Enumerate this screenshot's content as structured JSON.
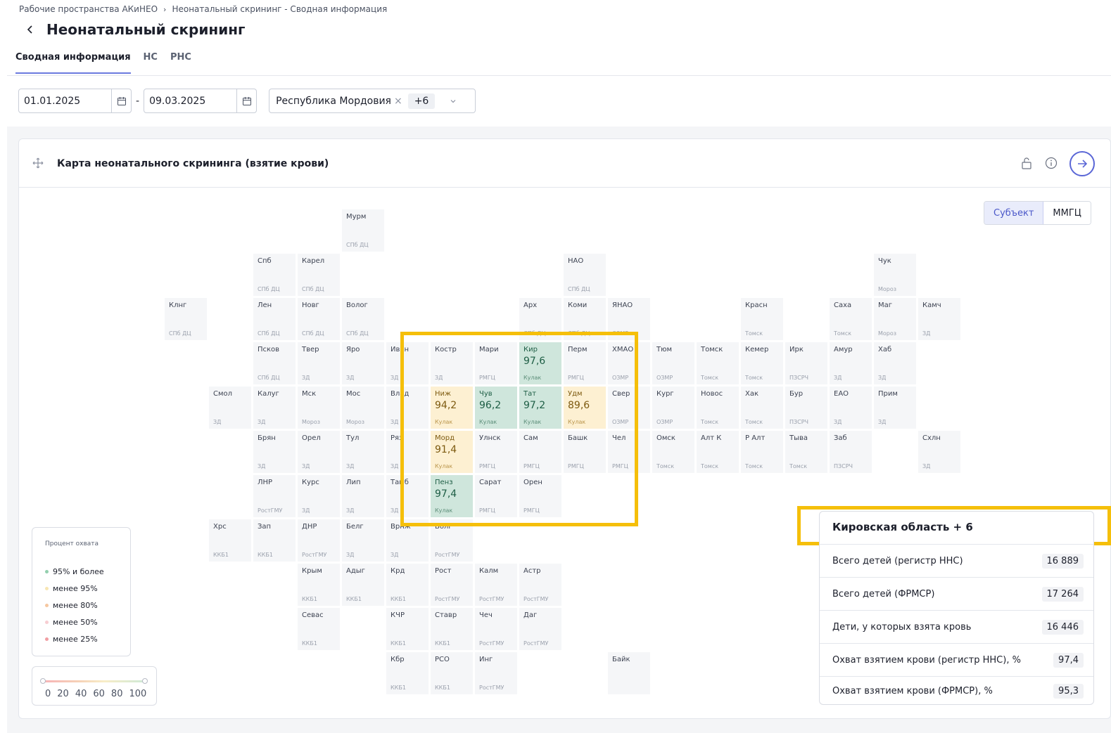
{
  "breadcrumb": {
    "root": "Рабочие пространства АКиНЕО",
    "current": "Неонатальный скрининг - Сводная информация"
  },
  "page": {
    "title": "Неонатальный скрининг"
  },
  "tabs": [
    "Сводная информация",
    "НС",
    "РНС"
  ],
  "filters": {
    "date_from": "01.01.2025",
    "date_to": "09.03.2025",
    "region_chip": "Республика Мордовия",
    "region_more": "+6"
  },
  "card": {
    "title": "Карта неонатального скрининга (взятие крови)"
  },
  "toggle": {
    "subject": "Субъект",
    "mmgc": "ММГЦ"
  },
  "regions": [
    {
      "id": "murm",
      "name": "Мурм",
      "org": "СПб ДЦ",
      "state": "none"
    },
    {
      "id": "spb",
      "name": "Спб",
      "org": "СПб ДЦ",
      "state": "none"
    },
    {
      "id": "karel",
      "name": "Карел",
      "org": "СПб ДЦ",
      "state": "none"
    },
    {
      "id": "nao",
      "name": "НАО",
      "org": "СПб ДЦ",
      "state": "none"
    },
    {
      "id": "chuk",
      "name": "Чук",
      "org": "Мороз",
      "state": "none"
    },
    {
      "id": "klng",
      "name": "Клнг",
      "org": "СПб ДЦ",
      "state": "none"
    },
    {
      "id": "len",
      "name": "Лен",
      "org": "СПб ДЦ",
      "state": "none"
    },
    {
      "id": "novg",
      "name": "Новг",
      "org": "СПб ДЦ",
      "state": "none"
    },
    {
      "id": "volog",
      "name": "Волог",
      "org": "СПб ДЦ",
      "state": "none"
    },
    {
      "id": "arh",
      "name": "Арх",
      "org": "СПб ДЦ",
      "state": "none"
    },
    {
      "id": "komi",
      "name": "Коми",
      "org": "СПб ДЦ",
      "state": "none"
    },
    {
      "id": "yanao",
      "name": "ЯНАО",
      "org": "ОЗМР",
      "state": "none"
    },
    {
      "id": "krasn",
      "name": "Красн",
      "org": "Томск",
      "state": "none"
    },
    {
      "id": "saha",
      "name": "Саха",
      "org": "Томск",
      "state": "none"
    },
    {
      "id": "mag",
      "name": "Маг",
      "org": "Мороз",
      "state": "none"
    },
    {
      "id": "kamch",
      "name": "Камч",
      "org": "ЗД",
      "state": "none"
    },
    {
      "id": "pskov",
      "name": "Псков",
      "org": "СПб ДЦ",
      "state": "none"
    },
    {
      "id": "tver",
      "name": "Твер",
      "org": "ЗД",
      "state": "none"
    },
    {
      "id": "yaro",
      "name": "Яро",
      "org": "ЗД",
      "state": "none"
    },
    {
      "id": "ivan",
      "name": "Иван",
      "org": "ЗД",
      "state": "none"
    },
    {
      "id": "kostr",
      "name": "Костр",
      "org": "ЗД",
      "state": "none"
    },
    {
      "id": "mari",
      "name": "Мари",
      "org": "РМГЦ",
      "state": "none"
    },
    {
      "id": "kir",
      "name": "Кир",
      "org": "Кулак",
      "value": "97,6",
      "state": "green"
    },
    {
      "id": "perm",
      "name": "Перм",
      "org": "РМГЦ",
      "state": "none"
    },
    {
      "id": "hmao",
      "name": "ХМАО",
      "org": "ОЗМР",
      "state": "none"
    },
    {
      "id": "tyum",
      "name": "Тюм",
      "org": "ОЗМР",
      "state": "none"
    },
    {
      "id": "tomsk",
      "name": "Томск",
      "org": "Томск",
      "state": "none"
    },
    {
      "id": "kemer",
      "name": "Кемер",
      "org": "Томск",
      "state": "none"
    },
    {
      "id": "irk",
      "name": "Ирк",
      "org": "ПЗСРЧ",
      "state": "none"
    },
    {
      "id": "amur",
      "name": "Амур",
      "org": "ЗД",
      "state": "none"
    },
    {
      "id": "hab",
      "name": "Хаб",
      "org": "ЗД",
      "state": "none"
    },
    {
      "id": "smol",
      "name": "Смол",
      "org": "ЗД",
      "state": "none"
    },
    {
      "id": "kalug",
      "name": "Калуг",
      "org": "ЗД",
      "state": "none"
    },
    {
      "id": "msk",
      "name": "Мск",
      "org": "Мороз",
      "state": "none"
    },
    {
      "id": "mos",
      "name": "Мос",
      "org": "Мороз",
      "state": "none"
    },
    {
      "id": "vlad",
      "name": "Влад",
      "org": "ЗД",
      "state": "none"
    },
    {
      "id": "nizh",
      "name": "Ниж",
      "org": "Кулак",
      "value": "94,2",
      "state": "yellow"
    },
    {
      "id": "chuv",
      "name": "Чув",
      "org": "Кулак",
      "value": "96,2",
      "state": "green"
    },
    {
      "id": "tat",
      "name": "Тат",
      "org": "Кулак",
      "value": "97,2",
      "state": "green"
    },
    {
      "id": "udm",
      "name": "Удм",
      "org": "Кулак",
      "value": "89,6",
      "state": "yellow"
    },
    {
      "id": "sver",
      "name": "Свер",
      "org": "ОЗМР",
      "state": "none"
    },
    {
      "id": "kurg",
      "name": "Кург",
      "org": "ОЗМР",
      "state": "none"
    },
    {
      "id": "novos",
      "name": "Новос",
      "org": "Томск",
      "state": "none"
    },
    {
      "id": "hak",
      "name": "Хак",
      "org": "Томск",
      "state": "none"
    },
    {
      "id": "bur",
      "name": "Бур",
      "org": "ПЗСРЧ",
      "state": "none"
    },
    {
      "id": "eao",
      "name": "ЕАО",
      "org": "ЗД",
      "state": "none"
    },
    {
      "id": "prim",
      "name": "Прим",
      "org": "ЗД",
      "state": "none"
    },
    {
      "id": "bryan",
      "name": "Брян",
      "org": "ЗД",
      "state": "none"
    },
    {
      "id": "orel",
      "name": "Орел",
      "org": "ЗД",
      "state": "none"
    },
    {
      "id": "tul",
      "name": "Тул",
      "org": "ЗД",
      "state": "none"
    },
    {
      "id": "ryaz",
      "name": "Ряз",
      "org": "ЗД",
      "state": "none"
    },
    {
      "id": "mord",
      "name": "Морд",
      "org": "Кулак",
      "value": "91,4",
      "state": "yellow"
    },
    {
      "id": "ulnsk",
      "name": "Улнск",
      "org": "РМГЦ",
      "state": "none"
    },
    {
      "id": "sam",
      "name": "Сам",
      "org": "РМГЦ",
      "state": "none"
    },
    {
      "id": "bash",
      "name": "Башк",
      "org": "РМГЦ",
      "state": "none"
    },
    {
      "id": "chel",
      "name": "Чел",
      "org": "РМГЦ",
      "state": "none"
    },
    {
      "id": "omsk",
      "name": "Омск",
      "org": "Томск",
      "state": "none"
    },
    {
      "id": "altk",
      "name": "Алт К",
      "org": "Томск",
      "state": "none"
    },
    {
      "id": "ralt",
      "name": "Р Алт",
      "org": "Томск",
      "state": "none"
    },
    {
      "id": "tyva",
      "name": "Тыва",
      "org": "Томск",
      "state": "none"
    },
    {
      "id": "zab",
      "name": "Заб",
      "org": "ПЗСРЧ",
      "state": "none"
    },
    {
      "id": "shln",
      "name": "Схлн",
      "org": "ЗД",
      "state": "none"
    },
    {
      "id": "lnr",
      "name": "ЛНР",
      "org": "РостГМУ",
      "state": "none"
    },
    {
      "id": "kurs",
      "name": "Курс",
      "org": "ЗД",
      "state": "none"
    },
    {
      "id": "lip",
      "name": "Лип",
      "org": "ЗД",
      "state": "none"
    },
    {
      "id": "tamb",
      "name": "Тамб",
      "org": "ЗД",
      "state": "none"
    },
    {
      "id": "penz",
      "name": "Пенз",
      "org": "Кулак",
      "value": "97,4",
      "state": "green"
    },
    {
      "id": "sarat",
      "name": "Сарат",
      "org": "РМГЦ",
      "state": "none"
    },
    {
      "id": "oren",
      "name": "Орен",
      "org": "РМГЦ",
      "state": "none"
    },
    {
      "id": "hrs",
      "name": "Хрс",
      "org": "ККБ1",
      "state": "none"
    },
    {
      "id": "zap",
      "name": "Зап",
      "org": "ККБ1",
      "state": "none"
    },
    {
      "id": "dnr",
      "name": "ДНР",
      "org": "РостГМУ",
      "state": "none"
    },
    {
      "id": "belg",
      "name": "Белг",
      "org": "ЗД",
      "state": "none"
    },
    {
      "id": "vrnzh",
      "name": "Врнж",
      "org": "ЗД",
      "state": "none"
    },
    {
      "id": "volg",
      "name": "Волг",
      "org": "РостГМУ",
      "state": "none"
    },
    {
      "id": "krym",
      "name": "Крым",
      "org": "ККБ1",
      "state": "none"
    },
    {
      "id": "adyg",
      "name": "Адыг",
      "org": "ККБ1",
      "state": "none"
    },
    {
      "id": "krd",
      "name": "Крд",
      "org": "ККБ1",
      "state": "none"
    },
    {
      "id": "rost",
      "name": "Рост",
      "org": "РостГМУ",
      "state": "none"
    },
    {
      "id": "kalm",
      "name": "Калм",
      "org": "РостГМУ",
      "state": "none"
    },
    {
      "id": "astr",
      "name": "Астр",
      "org": "РостГМУ",
      "state": "none"
    },
    {
      "id": "sevas",
      "name": "Севас",
      "org": "ККБ1",
      "state": "none"
    },
    {
      "id": "kchr",
      "name": "КЧР",
      "org": "ККБ1",
      "state": "none"
    },
    {
      "id": "stavr",
      "name": "Ставр",
      "org": "ККБ1",
      "state": "none"
    },
    {
      "id": "chech",
      "name": "Чеч",
      "org": "РостГМУ",
      "state": "none"
    },
    {
      "id": "dag",
      "name": "Даг",
      "org": "РостГМУ",
      "state": "none"
    },
    {
      "id": "kbr",
      "name": "Кбр",
      "org": "ККБ1",
      "state": "none"
    },
    {
      "id": "rso",
      "name": "РСО",
      "org": "ККБ1",
      "state": "none"
    },
    {
      "id": "ing",
      "name": "Инг",
      "org": "РостГМУ",
      "state": "none"
    },
    {
      "id": "baik",
      "name": "Байк",
      "org": "",
      "state": "none"
    }
  ],
  "legend": {
    "title": "Процент охвата",
    "items": [
      {
        "label": "95% и более",
        "color": "#93cfae"
      },
      {
        "label": "менее 95%",
        "color": "#f8e6b3"
      },
      {
        "label": "менее 80%",
        "color": "#f6c7a0"
      },
      {
        "label": "менее 50%",
        "color": "#f7cdd1"
      },
      {
        "label": "менее 25%",
        "color": "#f19ea3"
      }
    ]
  },
  "scale": {
    "ticks": [
      "0",
      "20",
      "40",
      "60",
      "80",
      "100"
    ],
    "range": [
      0,
      100
    ]
  },
  "summary": {
    "title": "Кировская область + 6",
    "rows": [
      {
        "label": "Всего детей (регистр ННС)",
        "value": "16 889"
      },
      {
        "label": "Всего детей (ФРМСР)",
        "value": "17 264"
      },
      {
        "label": "Дети, у которых взята кровь",
        "value": "16 446"
      },
      {
        "label": "Охват взятием крови (регистр ННС), %",
        "value": "97,4"
      },
      {
        "label": "Охват взятием крови (ФРМСР), %",
        "value": "95,3"
      }
    ]
  },
  "colors": {
    "accent": "#5a66d6",
    "highlight": "#f5bf0a",
    "green_tile": "#cfe6dc",
    "yellow_tile": "#fdf0d2"
  }
}
